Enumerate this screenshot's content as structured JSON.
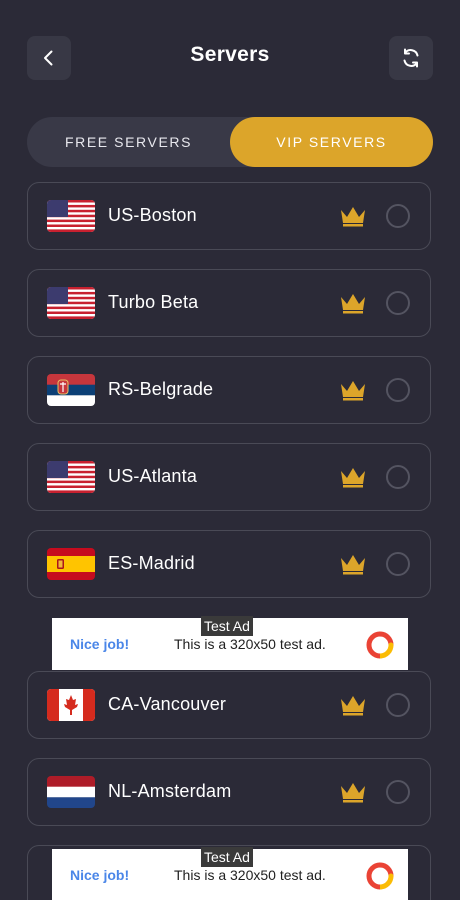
{
  "header": {
    "title": "Servers",
    "back_icon": "chevron-left-icon",
    "refresh_icon": "refresh-icon"
  },
  "tabs": {
    "free_label": "FREE SERVERS",
    "vip_label": "VIP SERVERS",
    "selected": "VIP SERVERS"
  },
  "colors": {
    "background": "#2b2a37",
    "accent": "#dca52a",
    "card_border": "#4a4a56"
  },
  "servers": [
    {
      "name": "US-Boston",
      "flag": "us-flag",
      "tier": "crown-icon"
    },
    {
      "name": "Turbo Beta",
      "flag": "us-flag",
      "tier": "crown-icon"
    },
    {
      "name": "RS-Belgrade",
      "flag": "serbia-flag",
      "tier": "crown-icon"
    },
    {
      "name": "US-Atlanta",
      "flag": "us-flag",
      "tier": "crown-icon"
    },
    {
      "name": "ES-Madrid",
      "flag": "spain-flag",
      "tier": "crown-icon"
    },
    {
      "name": "CA-Vancouver",
      "flag": "canada-flag",
      "tier": "crown-icon"
    },
    {
      "name": "NL-Amsterdam",
      "flag": "netherlands-flag",
      "tier": "crown-icon"
    }
  ],
  "ads": [
    {
      "badge": "Test Ad",
      "headline": "Nice job!",
      "body": "This is a 320x50 test ad."
    },
    {
      "badge": "Test Ad",
      "headline": "Nice job!",
      "body": "This is a 320x50 test ad."
    }
  ]
}
